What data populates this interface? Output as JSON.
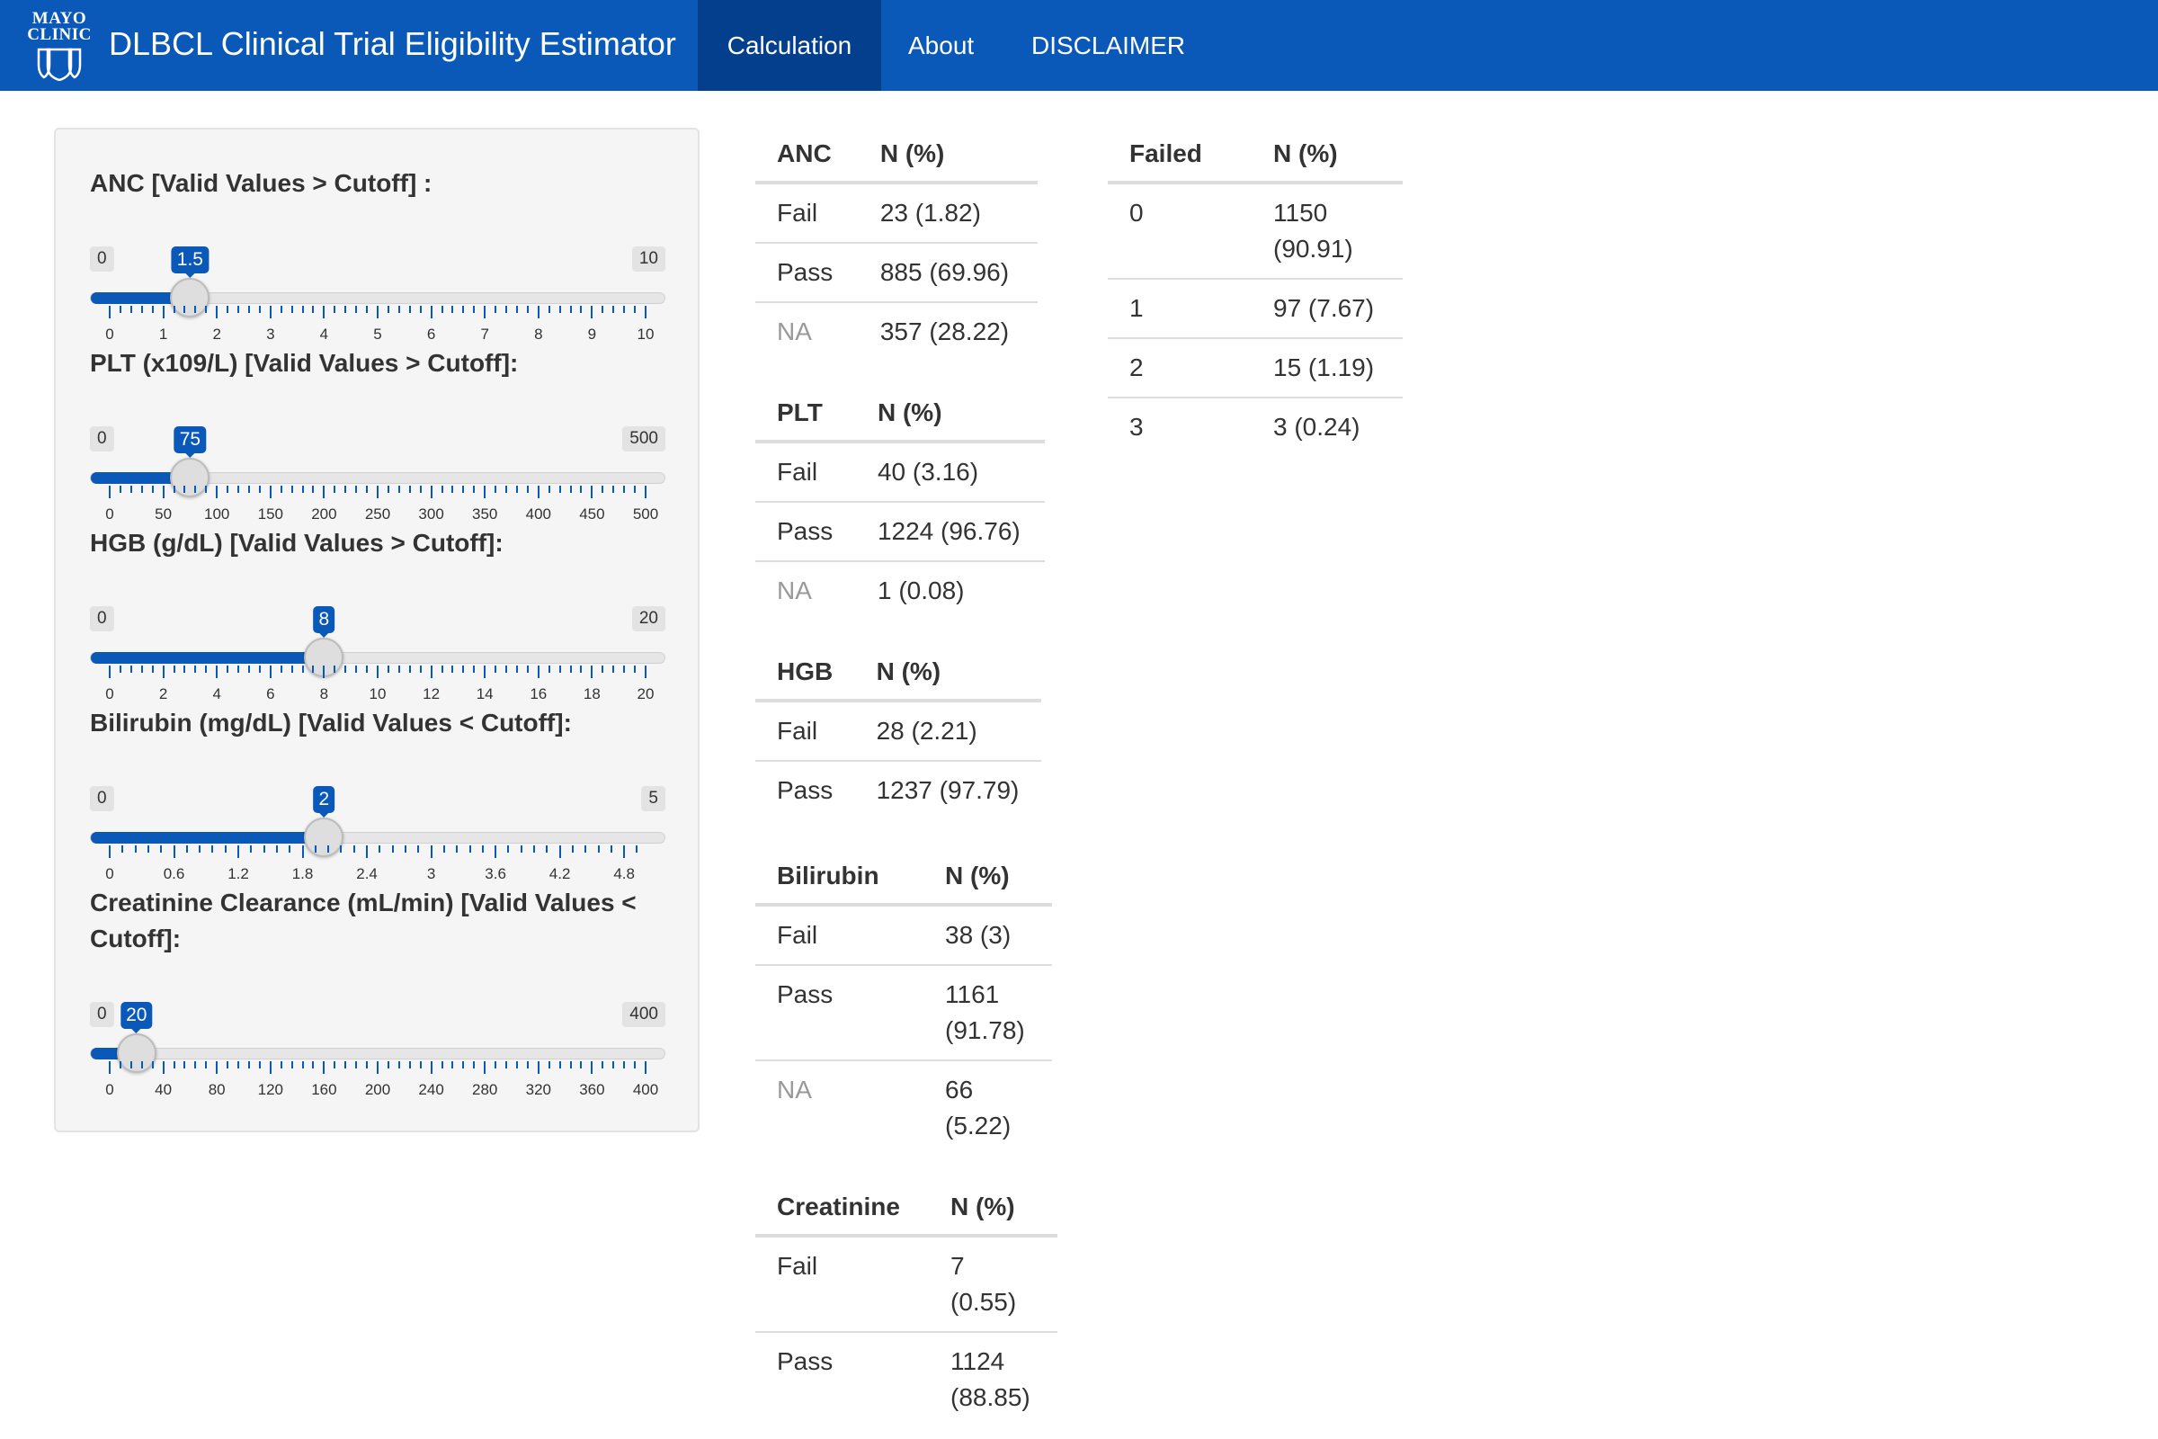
{
  "navbar": {
    "logo_line1": "MAYO",
    "logo_line2": "CLINIC",
    "logo_icon": "three-shields-icon",
    "title": "DLBCL Clinical Trial Eligibility Estimator",
    "tabs": [
      {
        "label": "Calculation",
        "active": true
      },
      {
        "label": "About",
        "active": false
      },
      {
        "label": "DISCLAIMER",
        "active": false
      }
    ]
  },
  "colors": {
    "brand_blue": "#0a59b8",
    "active_tab": "#043f8e",
    "panel_bg": "#f5f5f5",
    "na_text": "#999999"
  },
  "sliders": [
    {
      "label": "ANC [Valid Values > Cutoff] :",
      "min": "0",
      "max": "10",
      "value": "1.5",
      "ticks": [
        "0",
        "1",
        "2",
        "3",
        "4",
        "5",
        "6",
        "7",
        "8",
        "9",
        "10"
      ]
    },
    {
      "label": "PLT (x109/L) [Valid Values > Cutoff]:",
      "min": "0",
      "max": "500",
      "value": "75",
      "ticks": [
        "0",
        "50",
        "100",
        "150",
        "200",
        "250",
        "300",
        "350",
        "400",
        "450",
        "500"
      ]
    },
    {
      "label": "HGB (g/dL) [Valid Values > Cutoff]:",
      "min": "0",
      "max": "20",
      "value": "8",
      "ticks": [
        "0",
        "2",
        "4",
        "6",
        "8",
        "10",
        "12",
        "14",
        "16",
        "18",
        "20"
      ]
    },
    {
      "label": "Bilirubin (mg/dL) [Valid Values < Cutoff]:",
      "min": "0",
      "max": "5",
      "value": "2",
      "ticks": [
        "0",
        "0.6",
        "1.2",
        "1.8",
        "2.4",
        "3",
        "3.6",
        "4.2",
        "4.8"
      ]
    },
    {
      "label": "Creatinine Clearance (mL/min) [Valid Values < Cutoff]:",
      "min": "0",
      "max": "400",
      "value": "20",
      "ticks": [
        "0",
        "40",
        "80",
        "120",
        "160",
        "200",
        "240",
        "280",
        "320",
        "360",
        "400"
      ]
    }
  ],
  "tables": {
    "anc": {
      "header": [
        "ANC",
        "N (%)"
      ],
      "rows": [
        [
          "Fail",
          "23 (1.82)"
        ],
        [
          "Pass",
          "885 (69.96)"
        ],
        [
          "NA",
          "357 (28.22)"
        ]
      ]
    },
    "plt": {
      "header": [
        "PLT",
        "N (%)"
      ],
      "rows": [
        [
          "Fail",
          "40 (3.16)"
        ],
        [
          "Pass",
          "1224 (96.76)"
        ],
        [
          "NA",
          "1 (0.08)"
        ]
      ]
    },
    "hgb": {
      "header": [
        "HGB",
        "N (%)"
      ],
      "rows": [
        [
          "Fail",
          "28 (2.21)"
        ],
        [
          "Pass",
          "1237 (97.79)"
        ]
      ]
    },
    "bilirubin": {
      "header": [
        "Bilirubin",
        "N (%)"
      ],
      "rows": [
        [
          "Fail",
          "38 (3)"
        ],
        [
          "Pass",
          "1161 (91.78)"
        ],
        [
          "NA",
          "66 (5.22)"
        ]
      ]
    },
    "creatinine": {
      "header": [
        "Creatinine",
        "N (%)"
      ],
      "rows": [
        [
          "Fail",
          "7 (0.55)"
        ],
        [
          "Pass",
          "1124 (88.85)"
        ]
      ]
    },
    "failed": {
      "header": [
        "Failed",
        "N (%)"
      ],
      "rows": [
        [
          "0",
          "1150 (90.91)"
        ],
        [
          "1",
          "97 (7.67)"
        ],
        [
          "2",
          "15 (1.19)"
        ],
        [
          "3",
          "3 (0.24)"
        ]
      ]
    }
  }
}
